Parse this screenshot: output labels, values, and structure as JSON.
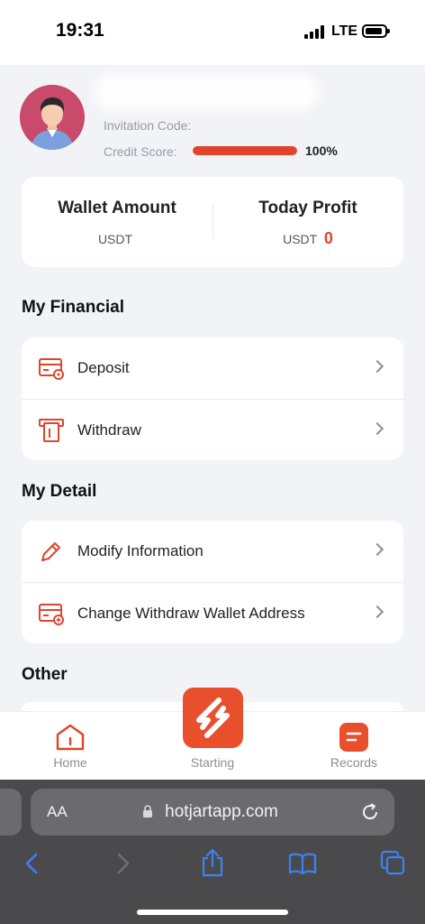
{
  "status": {
    "time": "19:31",
    "network": "LTE"
  },
  "profile": {
    "invitation_label": "Invitation Code:",
    "invitation_value": "",
    "credit_label": "Credit Score:",
    "credit_value": "100%",
    "credit_fraction": 1.0
  },
  "wallet": {
    "amount_title": "Wallet Amount",
    "amount_unit": "USDT",
    "amount_value": "",
    "profit_title": "Today Profit",
    "profit_unit": "USDT",
    "profit_value": "0"
  },
  "financial": {
    "title": "My Financial",
    "items": [
      {
        "label": "Deposit",
        "icon": "deposit-icon"
      },
      {
        "label": "Withdraw",
        "icon": "withdraw-icon"
      }
    ]
  },
  "detail": {
    "title": "My Detail",
    "items": [
      {
        "label": "Modify Information",
        "icon": "pencil-icon"
      },
      {
        "label": "Change Withdraw Wallet Address",
        "icon": "wallet-add-icon"
      }
    ]
  },
  "other": {
    "title": "Other"
  },
  "tabbar": {
    "home": "Home",
    "starting": "Starting",
    "records": "Records"
  },
  "browser": {
    "aa_label": "AA",
    "url": "hotjartapp.com"
  },
  "colors": {
    "accent": "#e0442b",
    "accent_button": "#e8502d"
  }
}
